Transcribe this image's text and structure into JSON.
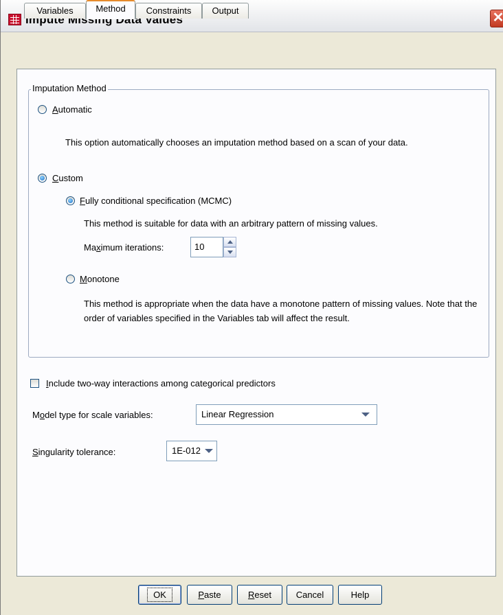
{
  "window": {
    "title": "Impute Missing Data Values",
    "close_glyph": "✕"
  },
  "tabs": [
    {
      "label": "Variables",
      "active": false
    },
    {
      "label": "Method",
      "active": true
    },
    {
      "label": "Constraints",
      "active": false
    },
    {
      "label": "Output",
      "active": false
    }
  ],
  "imputation": {
    "group_title": "Imputation Method",
    "automatic": {
      "label_hotkey": "A",
      "label_rest": "utomatic",
      "selected": false,
      "description": "This option automatically chooses an imputation method based on a scan of your data."
    },
    "custom": {
      "label_hotkey": "C",
      "label_rest": "ustom",
      "selected": true
    },
    "fcs": {
      "label_hotkey": "F",
      "label_rest": "ully conditional specification (MCMC)",
      "selected": true,
      "description": "This method is suitable for data with an arbitrary pattern of missing values.",
      "max_iterations_label_pre": "Ma",
      "max_iterations_label_hotkey": "x",
      "max_iterations_label_post": "imum iterations:",
      "max_iterations_value": "10"
    },
    "monotone": {
      "label_hotkey": "M",
      "label_rest": "onotone",
      "selected": false,
      "description": "This method is appropriate when the data have a monotone pattern of missing values. Note that the order of variables specified in the Variables tab will affect the result."
    }
  },
  "interactions": {
    "label_hotkey": "I",
    "label_rest": "nclude two-way interactions among categorical predictors",
    "checked": false
  },
  "model_type": {
    "label_pre": "M",
    "label_hotkey": "o",
    "label_post": "del type for scale variables:",
    "value": "Linear Regression"
  },
  "singularity": {
    "label_hotkey": "S",
    "label_rest": "ingularity tolerance:",
    "value": "1E-012"
  },
  "buttons": {
    "ok": "OK",
    "paste_hotkey": "P",
    "paste_rest": "aste",
    "reset_hotkey": "R",
    "reset_rest": "eset",
    "cancel": "Cancel",
    "help": "Help"
  }
}
